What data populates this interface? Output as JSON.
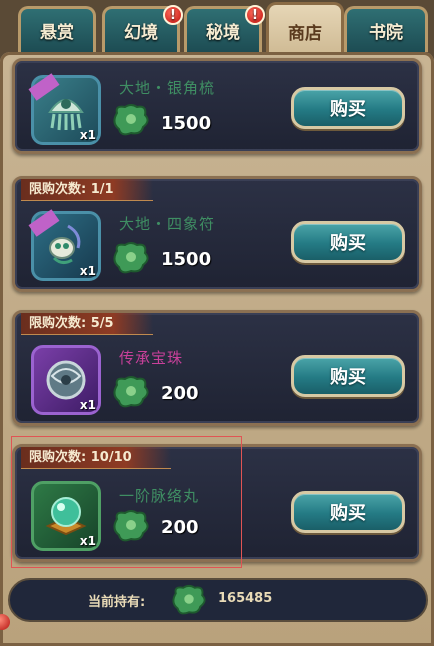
{
  "tabs": [
    {
      "label": "悬赏",
      "alert": false
    },
    {
      "label": "幻境",
      "alert": true
    },
    {
      "label": "秘境",
      "alert": true
    },
    {
      "label": "商店",
      "alert": false,
      "active": true
    },
    {
      "label": "书院",
      "alert": false
    }
  ],
  "alert_mark": "!",
  "items": [
    {
      "name": "大地・银角梳",
      "name_color": "#3f8e63",
      "limit": "",
      "quantity": "x1",
      "price": "1500",
      "buy_label": "购买",
      "icon": "comb-icon"
    },
    {
      "name": "大地・四象符",
      "name_color": "#3f8e63",
      "limit": "限购次数: 1/1",
      "quantity": "x1",
      "price": "1500",
      "buy_label": "购买",
      "icon": "talisman-icon"
    },
    {
      "name": "传承宝珠",
      "name_color": "#c8409a",
      "limit": "限购次数: 5/5",
      "quantity": "x1",
      "price": "200",
      "buy_label": "购买",
      "icon": "pearl-icon"
    },
    {
      "name": "一阶脉络丸",
      "name_color": "#3f8e63",
      "limit": "限购次数: 10/10",
      "quantity": "x1",
      "price": "200",
      "buy_label": "购买",
      "icon": "pill-icon"
    }
  ],
  "footer": {
    "label": "当前持有:",
    "value": "165485"
  },
  "currency_icon": "jade-currency-icon"
}
